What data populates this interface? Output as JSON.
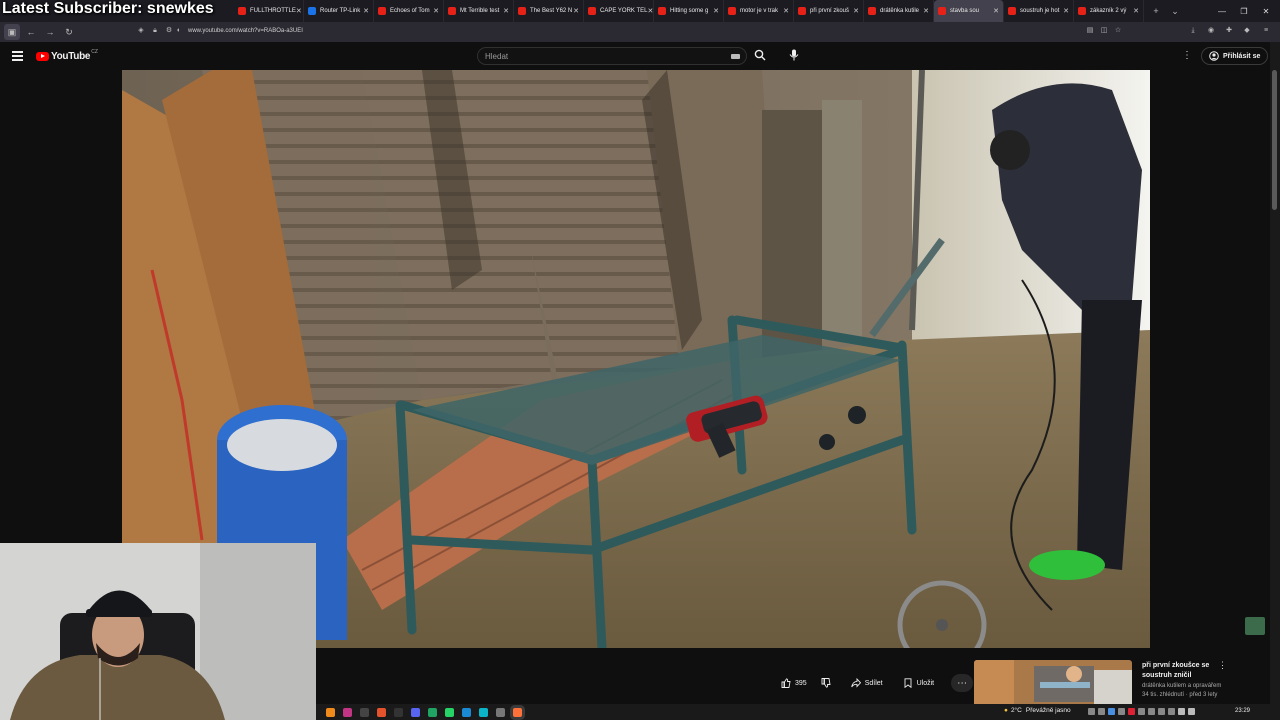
{
  "overlay": {
    "title": "Latest Subscriber: snewkes"
  },
  "tabs": [
    {
      "label": "FULLTHROTTLE",
      "color": "#e62117"
    },
    {
      "label": "Router TP-Link",
      "color": "#1a73e8"
    },
    {
      "label": "Echoes of Tom",
      "color": "#e62117"
    },
    {
      "label": "Mt Terrible test",
      "color": "#e62117"
    },
    {
      "label": "The Best Y62 N",
      "color": "#e62117"
    },
    {
      "label": "CAPE YORK TEL",
      "color": "#e62117"
    },
    {
      "label": "Hitting some g",
      "color": "#e62117"
    },
    {
      "label": "motor je v trak",
      "color": "#e62117"
    },
    {
      "label": "při první zkouš",
      "color": "#e62117"
    },
    {
      "label": "drátěnka kutile",
      "color": "#e62117"
    },
    {
      "label": "stavba sou",
      "color": "#e62117",
      "active": true
    },
    {
      "label": "soustruh je hot",
      "color": "#e62117"
    },
    {
      "label": "zákazník 2 vý",
      "color": "#e62117"
    }
  ],
  "browser": {
    "url": "www.youtube.com/watch?v=RABOa-a3UEI"
  },
  "youtube": {
    "country": "CZ",
    "logo_text": "YouTube",
    "search_placeholder": "Hledat",
    "signin_label": "Přihlásit se"
  },
  "actions": {
    "like_count": "395",
    "share_label": "Sdílet",
    "save_label": "Uložit"
  },
  "recommended": {
    "title": "při první zkoušce se soustruh zničil",
    "channel": "drátěnka kutilem a opravářem",
    "meta": "34 tis. zhlédnutí · před 3 lety"
  },
  "taskbar": {
    "weather": "2°C",
    "weather_desc": "Převážně jasno",
    "time": "23:29"
  },
  "colors": {
    "yt_red": "#ff0000",
    "bg": "#0f0f0f",
    "tab_active": "#42414d"
  }
}
